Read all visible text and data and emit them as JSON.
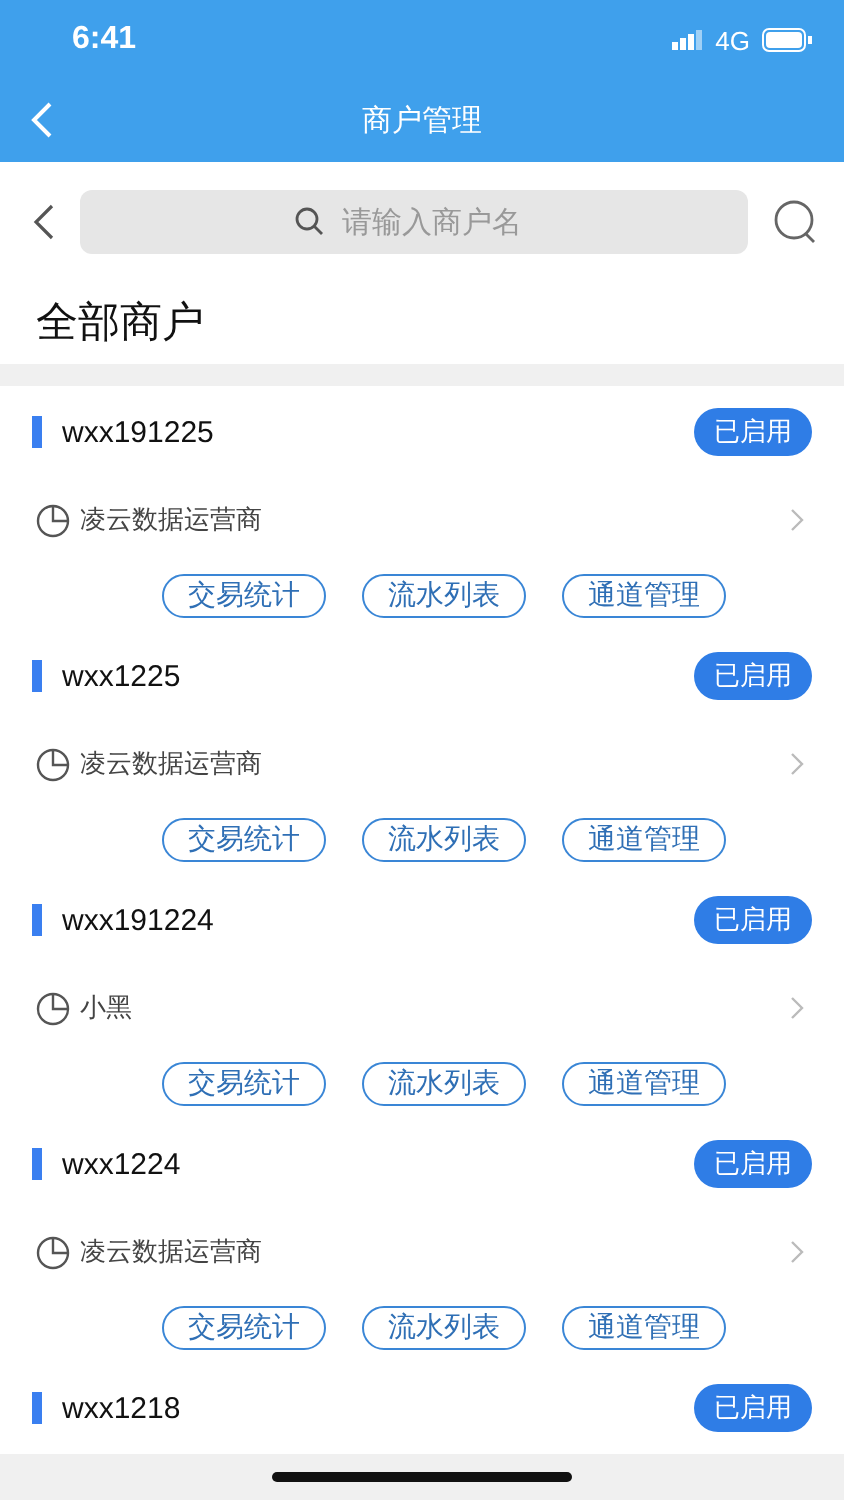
{
  "status_bar": {
    "time": "6:41",
    "network": "4G"
  },
  "nav": {
    "title": "商户管理"
  },
  "search": {
    "placeholder": "请输入商户名"
  },
  "section_title": "全部商户",
  "merchants": [
    {
      "name": "wxx191225",
      "status": "已启用",
      "operator": "凌云数据运营商",
      "actions": [
        "交易统计",
        "流水列表",
        "通道管理"
      ]
    },
    {
      "name": "wxx1225",
      "status": "已启用",
      "operator": "凌云数据运营商",
      "actions": [
        "交易统计",
        "流水列表",
        "通道管理"
      ]
    },
    {
      "name": "wxx191224",
      "status": "已启用",
      "operator": "小黑",
      "actions": [
        "交易统计",
        "流水列表",
        "通道管理"
      ]
    },
    {
      "name": "wxx1224",
      "status": "已启用",
      "operator": "凌云数据运营商",
      "actions": [
        "交易统计",
        "流水列表",
        "通道管理"
      ]
    },
    {
      "name": "wxx1218",
      "status": "已启用"
    }
  ]
}
